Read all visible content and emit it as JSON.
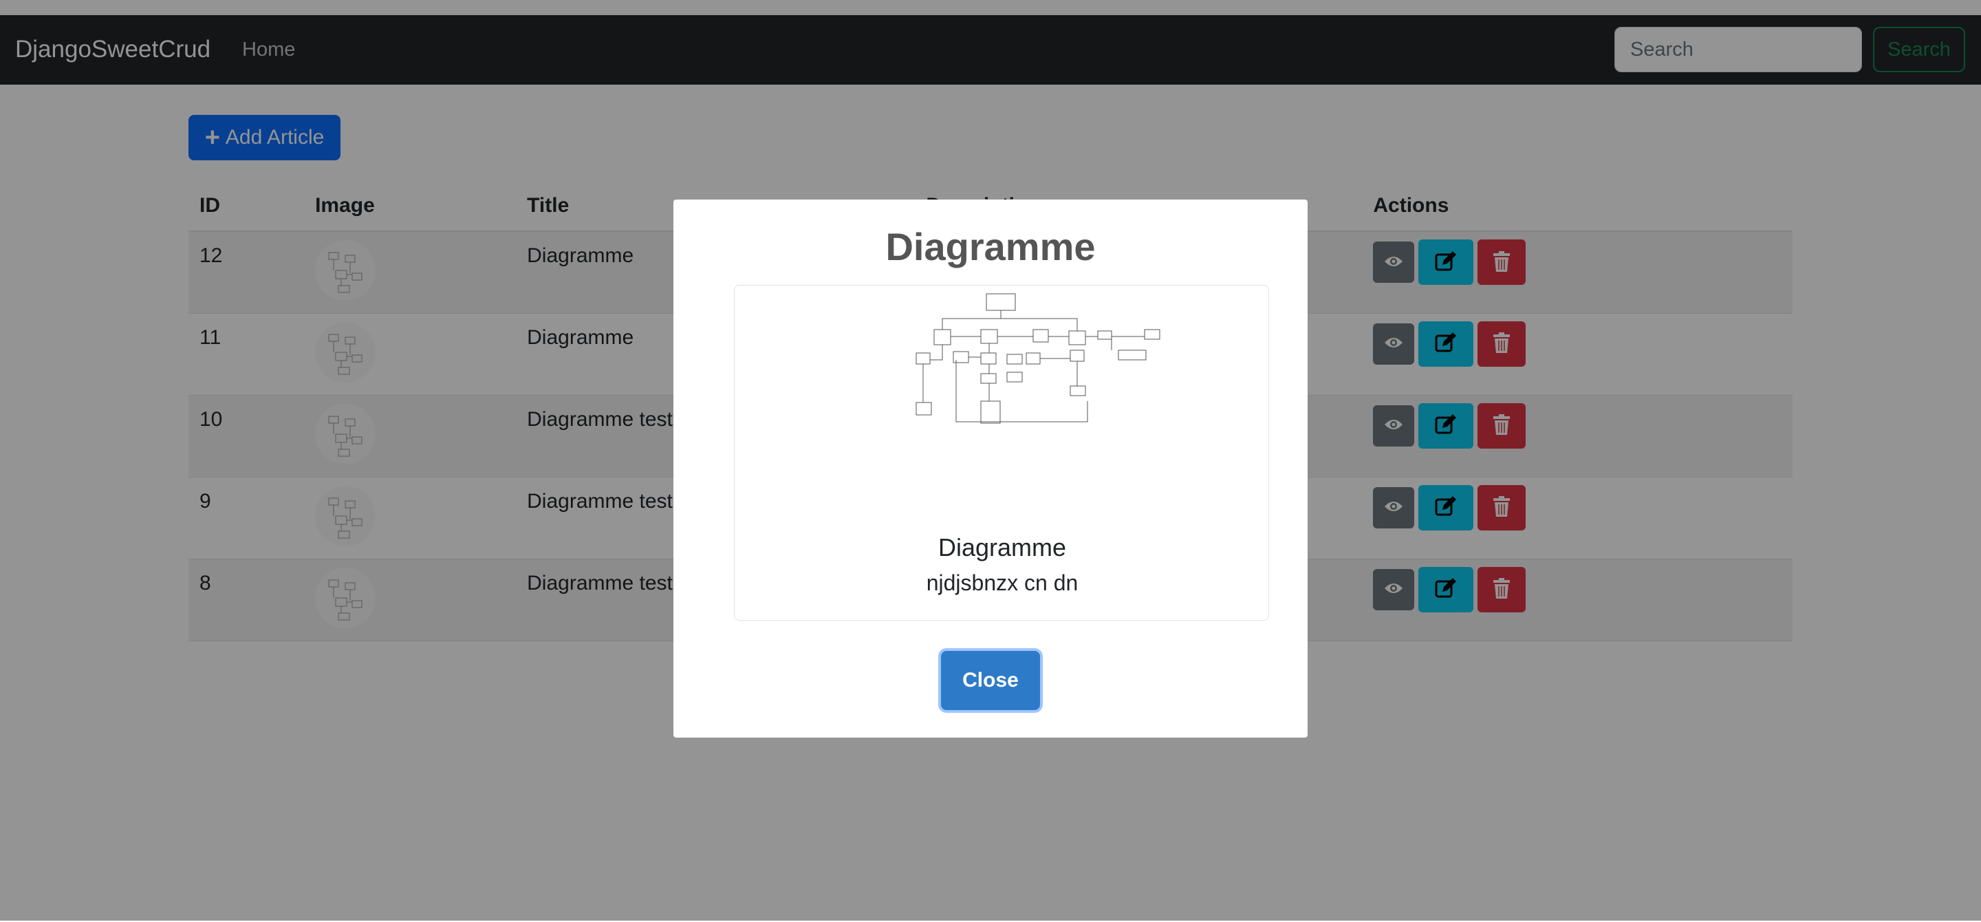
{
  "navbar": {
    "brand": "DjangoSweetCrud",
    "home": "Home",
    "search_placeholder": "Search",
    "search_button": "Search"
  },
  "toolbar": {
    "add_label": "Add Article",
    "add_icon": "plus-icon"
  },
  "table": {
    "headers": {
      "id": "ID",
      "image": "Image",
      "title": "Title",
      "description": "Description",
      "actions": "Actions"
    },
    "rows": [
      {
        "id": "12",
        "title": "Diagramme"
      },
      {
        "id": "11",
        "title": "Diagramme"
      },
      {
        "id": "10",
        "title": "Diagramme test"
      },
      {
        "id": "9",
        "title": "Diagramme test"
      },
      {
        "id": "8",
        "title": "Diagramme test"
      }
    ],
    "action_icons": [
      "eye-icon",
      "edit-icon",
      "trash-icon"
    ]
  },
  "modal": {
    "title": "Diagramme",
    "card_title": "Diagramme",
    "card_text": "njdjsbnzx cn dn",
    "close_label": "Close"
  },
  "colors": {
    "navbar": "#212529",
    "primary": "#0d6efd",
    "success": "#198754",
    "info": "#0dcaf0",
    "danger": "#dc3545",
    "secondary": "#6c757d",
    "modal_close": "#2d7bc8"
  }
}
